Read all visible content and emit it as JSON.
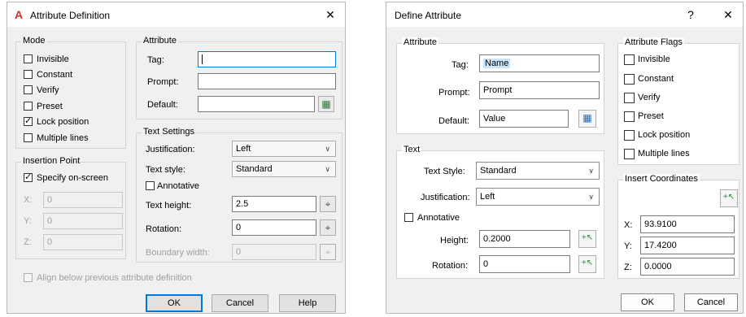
{
  "left": {
    "title": "Attribute Definition",
    "close": "✕",
    "mode": {
      "label": "Mode",
      "items": [
        {
          "label": "Invisible",
          "checked": false
        },
        {
          "label": "Constant",
          "checked": false
        },
        {
          "label": "Verify",
          "checked": false
        },
        {
          "label": "Preset",
          "checked": false
        },
        {
          "label": "Lock position",
          "checked": true
        },
        {
          "label": "Multiple lines",
          "checked": false
        }
      ]
    },
    "attribute": {
      "label": "Attribute",
      "tag_label": "Tag:",
      "tag_value": "",
      "prompt_label": "Prompt:",
      "prompt_value": "",
      "default_label": "Default:",
      "default_value": ""
    },
    "insertion": {
      "label": "Insertion Point",
      "specify_label": "Specify on-screen",
      "x_label": "X:",
      "x_value": "0",
      "y_label": "Y:",
      "y_value": "0",
      "z_label": "Z:",
      "z_value": "0"
    },
    "text_settings": {
      "label": "Text Settings",
      "justification_label": "Justification:",
      "justification_value": "Left",
      "style_label": "Text style:",
      "style_value": "Standard",
      "annotative_label": "Annotative",
      "height_label": "Text height:",
      "height_value": "2.5",
      "rotation_label": "Rotation:",
      "rotation_value": "0",
      "boundary_label": "Boundary width:",
      "boundary_value": "0"
    },
    "align_label": "Align below previous attribute definition",
    "ok": "OK",
    "cancel": "Cancel",
    "help": "Help"
  },
  "right": {
    "title": "Define Attribute",
    "help_q": "?",
    "close": "✕",
    "attribute": {
      "label": "Attribute",
      "tag_label": "Tag:",
      "tag_value": "Name",
      "prompt_label": "Prompt:",
      "prompt_value": "Prompt",
      "default_label": "Default:",
      "default_value": "Value"
    },
    "text": {
      "label": "Text",
      "style_label": "Text Style:",
      "style_value": "Standard",
      "justification_label": "Justification:",
      "justification_value": "Left",
      "annotative_label": "Annotative",
      "height_label": "Height:",
      "height_value": "0.2000",
      "rotation_label": "Rotation:",
      "rotation_value": "0"
    },
    "flags": {
      "label": "Attribute Flags",
      "items": [
        {
          "label": "Invisible",
          "checked": false
        },
        {
          "label": "Constant",
          "checked": false
        },
        {
          "label": "Verify",
          "checked": false
        },
        {
          "label": "Preset",
          "checked": false
        },
        {
          "label": "Lock position",
          "checked": false
        },
        {
          "label": "Multiple lines",
          "checked": false
        }
      ]
    },
    "coords": {
      "label": "Insert Coordinates",
      "x_label": "X:",
      "x_value": "93.9100",
      "y_label": "Y:",
      "y_value": "17.4200",
      "z_label": "Z:",
      "z_value": "0.0000"
    },
    "ok": "OK",
    "cancel": "Cancel"
  }
}
